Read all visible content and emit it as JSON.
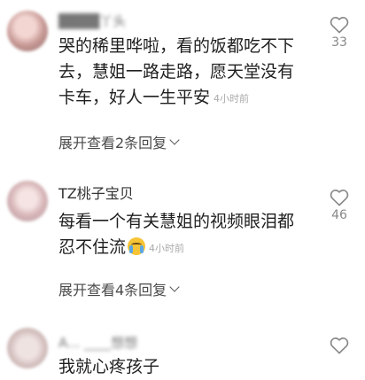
{
  "comments": [
    {
      "username": "████丫头",
      "username_blurred": true,
      "text_lines": [
        "哭的稀里哗啦，看的饭都吃不下",
        "去，慧姐一路走路，愿天堂没有",
        "卡车，好人一生平安"
      ],
      "time": "4小时前",
      "likes": "33",
      "expand_label": "展开查看2条回复"
    },
    {
      "username": "TZ桃子宝贝",
      "username_blurred": false,
      "text_lines": [
        "每看一个有关慧姐的视频眼泪都",
        "忍不住流"
      ],
      "emoji": "crying-face-emoji",
      "time": "4小时前",
      "likes": "46",
      "expand_label": "展开查看4条回复"
    },
    {
      "username": "A... ____想想",
      "username_blurred": true,
      "text_lines": [
        "我就心疼孩子"
      ],
      "likes": ""
    }
  ],
  "icons": {
    "like": "heart-icon",
    "expand": "chevron-down-icon"
  }
}
